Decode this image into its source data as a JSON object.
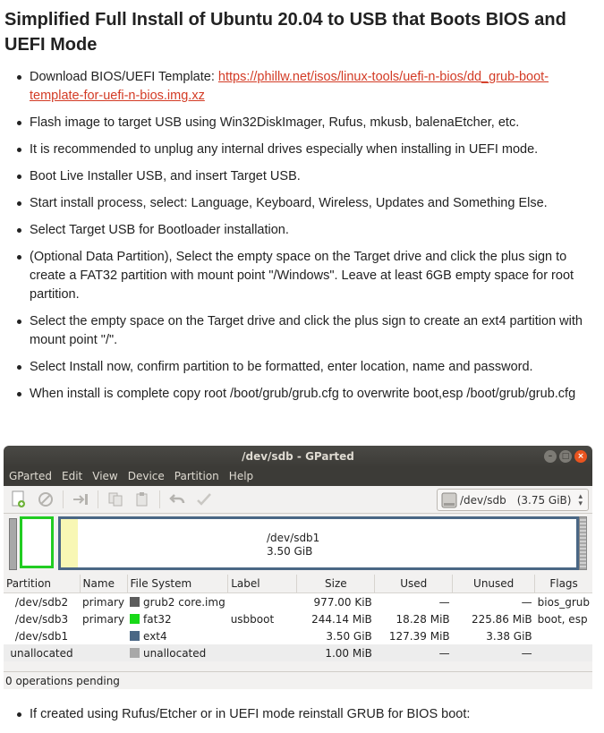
{
  "title": "Simplified Full Install of Ubuntu 20.04 to USB that Boots BIOS and UEFI Mode",
  "steps": [
    {
      "text": "Download BIOS/UEFI Template: ",
      "link": "https://phillw.net/isos/linux-tools/uefi-n-bios/dd_grub-boot-template-for-uefi-n-bios.img.xz"
    },
    {
      "text": "Flash image to target USB using Win32DiskImager, Rufus, mkusb, balenaEtcher, etc."
    },
    {
      "text": "It is recommended to unplug any internal drives especially when installing in UEFI mode."
    },
    {
      "text": "Boot Live Installer USB, and insert Target USB."
    },
    {
      "text": "Start install process, select: Language, Keyboard, Wireless, Updates and Something Else."
    },
    {
      "text": "Select Target USB for Bootloader installation."
    },
    {
      "text": "(Optional Data Partition), Select the empty space on the Target drive and click the plus sign to create a FAT32 partition with mount point \"/Windows\". Leave at least 6GB empty space for root partition."
    },
    {
      "text": "Select the empty space on the Target drive and click the plus sign to create an ext4 partition with mount point \"/\"."
    },
    {
      "text": "Select Install now, confirm partition to be formatted, enter location, name and password."
    },
    {
      "text": "When install is complete copy root /boot/grub/grub.cfg to overwrite boot,esp /boot/grub/grub.cfg"
    }
  ],
  "gparted": {
    "window_title": "/dev/sdb - GParted",
    "menu": [
      "GParted",
      "Edit",
      "View",
      "Device",
      "Partition",
      "Help"
    ],
    "device": "/dev/sdb",
    "device_size": "(3.75 GiB)",
    "disk_label_name": "/dev/sdb1",
    "disk_label_size": "3.50 GiB",
    "columns": [
      "Partition",
      "Name",
      "File System",
      "Label",
      "Size",
      "Used",
      "Unused",
      "Flags"
    ],
    "rows": [
      {
        "partition": "/dev/sdb2",
        "name": "primary",
        "fs": "grub2 core.img",
        "fs_color": "#5c5c5c",
        "label": "",
        "size": "977.00 KiB",
        "used": "—",
        "unused": "—",
        "flags": "bios_grub"
      },
      {
        "partition": "/dev/sdb3",
        "name": "primary",
        "fs": "fat32",
        "fs_color": "#18d918",
        "label": "usbboot",
        "size": "244.14 MiB",
        "used": "18.28 MiB",
        "unused": "225.86 MiB",
        "flags": "boot, esp"
      },
      {
        "partition": "/dev/sdb1",
        "name": "",
        "fs": "ext4",
        "fs_color": "#4a6785",
        "label": "",
        "size": "3.50 GiB",
        "used": "127.39 MiB",
        "unused": "3.38 GiB",
        "flags": ""
      },
      {
        "partition": "unallocated",
        "name": "",
        "fs": "unallocated",
        "fs_color": "#a8a8a8",
        "label": "",
        "size": "1.00 MiB",
        "used": "—",
        "unused": "—",
        "flags": ""
      }
    ],
    "status": "0 operations pending"
  },
  "final_step": "If created using Rufus/Etcher or in UEFI mode reinstall GRUB for BIOS boot:"
}
